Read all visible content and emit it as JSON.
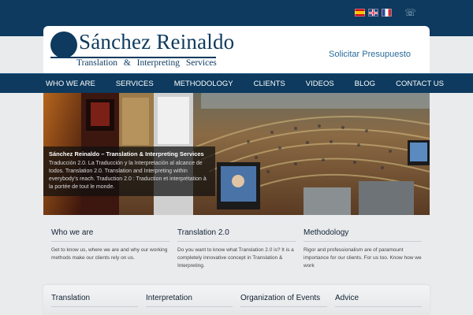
{
  "colors": {
    "primary": "#0d3a5e",
    "link": "#2a6a9a",
    "background": "#e9ebed"
  },
  "topbar": {
    "flags": [
      {
        "name": "spanish-flag-icon"
      },
      {
        "name": "uk-flag-icon"
      },
      {
        "name": "french-flag-icon"
      }
    ],
    "phone_icon": "☏"
  },
  "header": {
    "brand": "Sánchez Reinaldo",
    "tagline": "Translation & Interpreting Services",
    "quote_link": "Solicitar Presupuesto"
  },
  "nav": {
    "items": [
      "WHO WE ARE",
      "SERVICES",
      "METHODOLOGY",
      "CLIENTS",
      "VIDEOS",
      "BLOG",
      "CONTACT US"
    ]
  },
  "hero": {
    "caption_title": "Sánchez Reinaldo – Translation & Interpreting Services",
    "caption_text": "Traducción 2.0. La Traducción y la Interpretación al alcance de todos. Translation 2.0. Translation and Interpreting within everybody's reach. Traduction 2.0 : Traduction et interprétation à la portée de tout le monde."
  },
  "columns": [
    {
      "title": "Who we are",
      "text": "Get to know us, where we are and why our working methods make our clients rely on us."
    },
    {
      "title": "Translation 2.0",
      "text": "Do you want to know what Translation 2.0 is? It is a completely innovative concept in Translation & Interpreting."
    },
    {
      "title": "Methodology",
      "text": "Rigor and professionalism are of paramount importance for our clients. For us too. Know how we work"
    }
  ],
  "bottom": [
    "Translation",
    "Interpretation",
    "Organization of Events",
    "Advice"
  ]
}
